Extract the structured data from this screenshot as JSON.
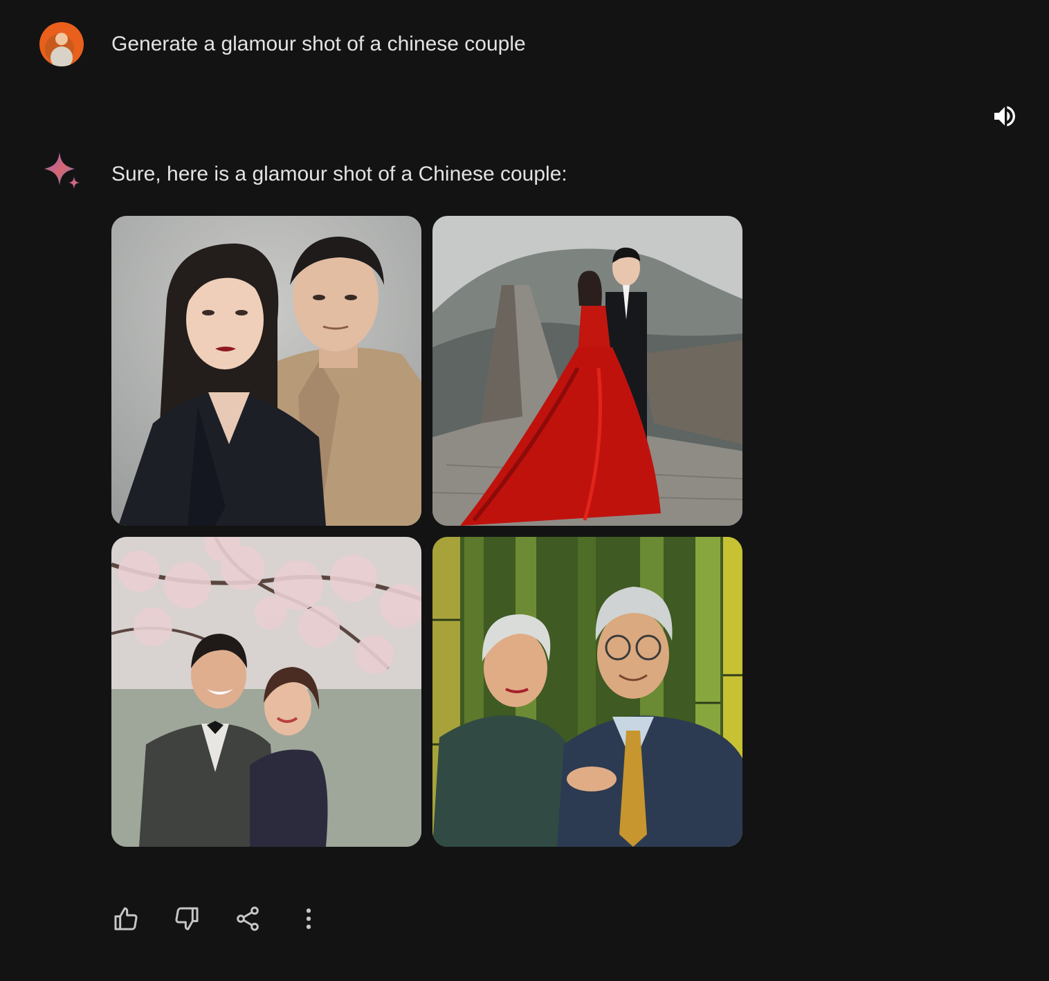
{
  "prompt": {
    "text": "Generate a glamour shot of a chinese couple"
  },
  "response": {
    "text": "Sure, here is a glamour shot of a Chinese couple:",
    "images": [
      {
        "subject": "studio portrait couple, dark blazer and beige jacket, grey backdrop"
      },
      {
        "subject": "couple on Great Wall, red gown and black suit, misty hills"
      },
      {
        "subject": "older couple laughing under cherry blossoms, tuxedo"
      },
      {
        "subject": "elderly couple in front of bamboo, gold tie, teal jacket"
      }
    ]
  },
  "actions": {
    "icons": [
      "thumb-up-icon",
      "thumb-down-icon",
      "share-icon",
      "more-vertical-icon"
    ]
  },
  "colors": {
    "background": "#131314",
    "text": "#e3e3e3",
    "icon": "#c4c7c5"
  }
}
